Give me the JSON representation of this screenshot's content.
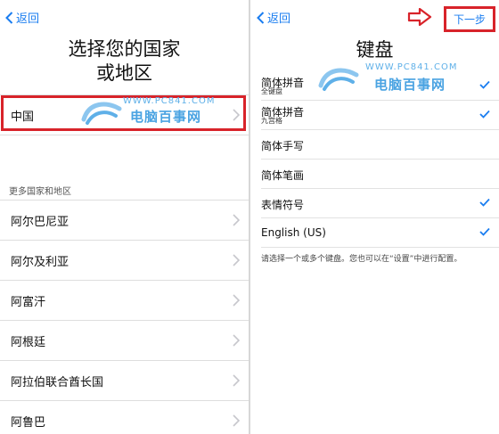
{
  "left": {
    "back_label": "返回",
    "title_line1": "选择您的国家",
    "title_line2": "或地区",
    "selected_country": "中国",
    "section_header": "更多国家和地区",
    "countries": [
      "阿尔巴尼亚",
      "阿尔及利亚",
      "阿富汗",
      "阿根廷",
      "阿拉伯联合酋长国",
      "阿鲁巴"
    ]
  },
  "right": {
    "back_label": "返回",
    "next_label": "下一步",
    "title": "键盘",
    "keyboards": [
      {
        "name": "简体拼音",
        "sub": "全键盘",
        "checked": true
      },
      {
        "name": "简体拼音",
        "sub": "九宫格",
        "checked": true
      },
      {
        "name": "简体手写",
        "sub": "",
        "checked": false
      },
      {
        "name": "简体笔画",
        "sub": "",
        "checked": false
      },
      {
        "name": "表情符号",
        "sub": "",
        "checked": true
      },
      {
        "name": "English (US)",
        "sub": "",
        "checked": true
      }
    ],
    "hint": "请选择一个或多个键盘。您也可以在“设置”中进行配置。"
  },
  "watermark": {
    "url": "WWW.PC841.COM",
    "name": "电脑百事网"
  },
  "colors": {
    "accent": "#1a7df0",
    "highlight": "#d8232a",
    "watermark": "#4aa3e2"
  }
}
